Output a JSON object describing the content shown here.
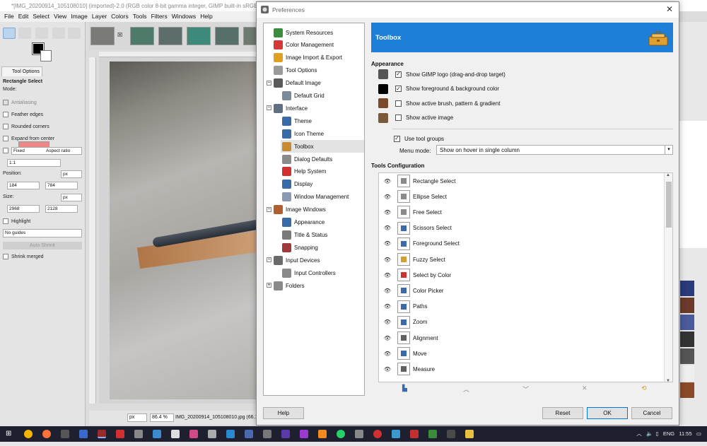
{
  "gimp": {
    "window_title": "*[IMG_20200914_105108010] (imported)-2.0 (RGB color 8-bit gamma integer, GIMP built-in sRGB",
    "menu": [
      "File",
      "Edit",
      "Select",
      "View",
      "Image",
      "Layer",
      "Colors",
      "Tools",
      "Filters",
      "Windows",
      "Help"
    ],
    "tool_options_tab": "Tool Options",
    "tool_options": {
      "tool_name": "Rectangle Select",
      "mode_label": "Mode:",
      "antialiasing": "Antialiasing",
      "feather_edges": "Feather edges",
      "rounded_corners": "Rounded corners",
      "expand_from_center": "Expand from center",
      "fixed": "Fixed",
      "aspect_ratio": "Aspect ratio",
      "ratio_value": "1:1",
      "position_label": "Position:",
      "position_unit": "px",
      "pos_x": "184",
      "pos_y": "784",
      "size_label": "Size:",
      "size_unit": "px",
      "size_w": "2968",
      "size_h": "2128",
      "highlight": "Highlight",
      "guides": "No guides",
      "auto_shrink": "Auto Shrink",
      "shrink_merged": "Shrink merged"
    },
    "status": {
      "unit": "px",
      "zoom": "86.4 %",
      "filename": "IMG_20200914_105108010.jpg (66.1"
    }
  },
  "prefs": {
    "title": "Preferences",
    "close_glyph": "✕",
    "nav": [
      {
        "label": "System Resources",
        "color": "#3a8d3a",
        "indent": 0
      },
      {
        "label": "Color Management",
        "color": "#d43a3a",
        "indent": 0
      },
      {
        "label": "Image Import & Export",
        "color": "#e0a020",
        "indent": 0
      },
      {
        "label": "Tool Options",
        "color": "#9a9a9a",
        "indent": 0
      },
      {
        "label": "Default Image",
        "color": "#5a5a5a",
        "indent": 0,
        "expander": "−"
      },
      {
        "label": "Default Grid",
        "color": "#7a8a9a",
        "indent": 1
      },
      {
        "label": "Interface",
        "color": "#607080",
        "indent": 0,
        "expander": "−"
      },
      {
        "label": "Theme",
        "color": "#3a6aa8",
        "indent": 1
      },
      {
        "label": "Icon Theme",
        "color": "#3a6aa8",
        "indent": 1
      },
      {
        "label": "Toolbox",
        "color": "#c88a30",
        "indent": 1,
        "selected": true
      },
      {
        "label": "Dialog Defaults",
        "color": "#8a8a8a",
        "indent": 1
      },
      {
        "label": "Help System",
        "color": "#d03030",
        "indent": 1
      },
      {
        "label": "Display",
        "color": "#3a6aa8",
        "indent": 1
      },
      {
        "label": "Window Management",
        "color": "#8a9ab0",
        "indent": 1
      },
      {
        "label": "Image Windows",
        "color": "#b06030",
        "indent": 0,
        "expander": "−"
      },
      {
        "label": "Appearance",
        "color": "#3a6aa8",
        "indent": 1
      },
      {
        "label": "Title & Status",
        "color": "#7a7a7a",
        "indent": 1
      },
      {
        "label": "Snapping",
        "color": "#a03a3a",
        "indent": 1
      },
      {
        "label": "Input Devices",
        "color": "#6a6a6a",
        "indent": 0,
        "expander": "−"
      },
      {
        "label": "Input Controllers",
        "color": "#8a8a8a",
        "indent": 1
      },
      {
        "label": "Folders",
        "color": "#8a8a8a",
        "indent": 0,
        "expander": "+"
      }
    ],
    "header": "Toolbox",
    "appearance_title": "Appearance",
    "options": [
      {
        "label": "Show GIMP logo (drag-and-drop target)",
        "checked": true,
        "icon": "gimp-logo-icon"
      },
      {
        "label": "Show foreground & background color",
        "checked": true,
        "icon": "fg-bg-color-icon"
      },
      {
        "label": "Show active brush, pattern & gradient",
        "checked": false,
        "icon": "brush-icon"
      },
      {
        "label": "Show active image",
        "checked": false,
        "icon": "image-icon"
      }
    ],
    "use_tool_groups": "Use tool groups",
    "use_tool_groups_checked": true,
    "menu_mode_label": "Menu mode:",
    "menu_mode_value": "Show on hover in single column",
    "tools_config_title": "Tools Configuration",
    "tools": [
      {
        "label": "Rectangle Select",
        "color": "#8a8a8a"
      },
      {
        "label": "Ellipse Select",
        "color": "#8a8a8a"
      },
      {
        "label": "Free Select",
        "color": "#8a8a8a"
      },
      {
        "label": "Scissors Select",
        "color": "#3a6aa8"
      },
      {
        "label": "Foreground Select",
        "color": "#3a6aa8"
      },
      {
        "label": "Fuzzy Select",
        "color": "#d0a030"
      },
      {
        "label": "Select by Color",
        "color": "#d03030"
      },
      {
        "label": "Color Picker",
        "color": "#3a6aa8"
      },
      {
        "label": "Paths",
        "color": "#3a6aa8"
      },
      {
        "label": "Zoom",
        "color": "#3a6aa8"
      },
      {
        "label": "Alignment",
        "color": "#606060"
      },
      {
        "label": "Move",
        "color": "#3a6aa8"
      },
      {
        "label": "Measure",
        "color": "#606060"
      }
    ],
    "buttons": {
      "help": "Help",
      "reset": "Reset",
      "ok": "OK",
      "cancel": "Cancel"
    }
  },
  "taskbar": {
    "lang": "ENG",
    "time": "11:55"
  },
  "colors": {
    "header_blue": "#1d7fd8",
    "taskbar": "#1e2030"
  }
}
